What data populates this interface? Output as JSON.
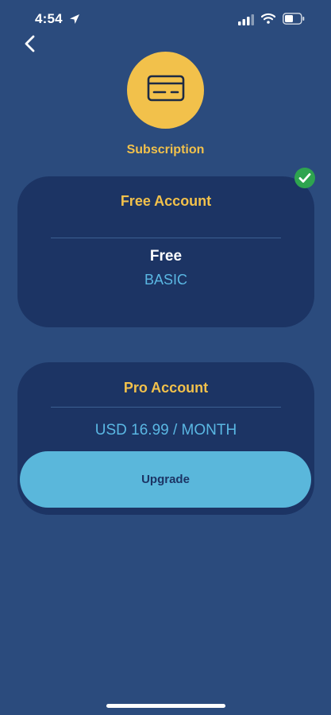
{
  "status_bar": {
    "time": "4:54",
    "icons": [
      "location-arrow-icon",
      "cellular-signal-icon",
      "wifi-icon",
      "battery-icon"
    ]
  },
  "nav": {
    "back_icon": "chevron-left-icon"
  },
  "header": {
    "icon": "credit-card-icon",
    "title": "Subscription"
  },
  "plans": {
    "free": {
      "title": "Free Account",
      "name": "Free",
      "tier": "BASIC",
      "selected": true,
      "selected_icon": "checkmark-circle-icon"
    },
    "pro": {
      "title": "Pro Account",
      "price": "USD 16.99 / MONTH",
      "button_label": "Upgrade"
    }
  },
  "colors": {
    "background": "#2b4b7d",
    "card": "#1c3464",
    "accent_yellow": "#f2c14b",
    "accent_blue": "#5ab7db",
    "check_green": "#2ea44f"
  }
}
